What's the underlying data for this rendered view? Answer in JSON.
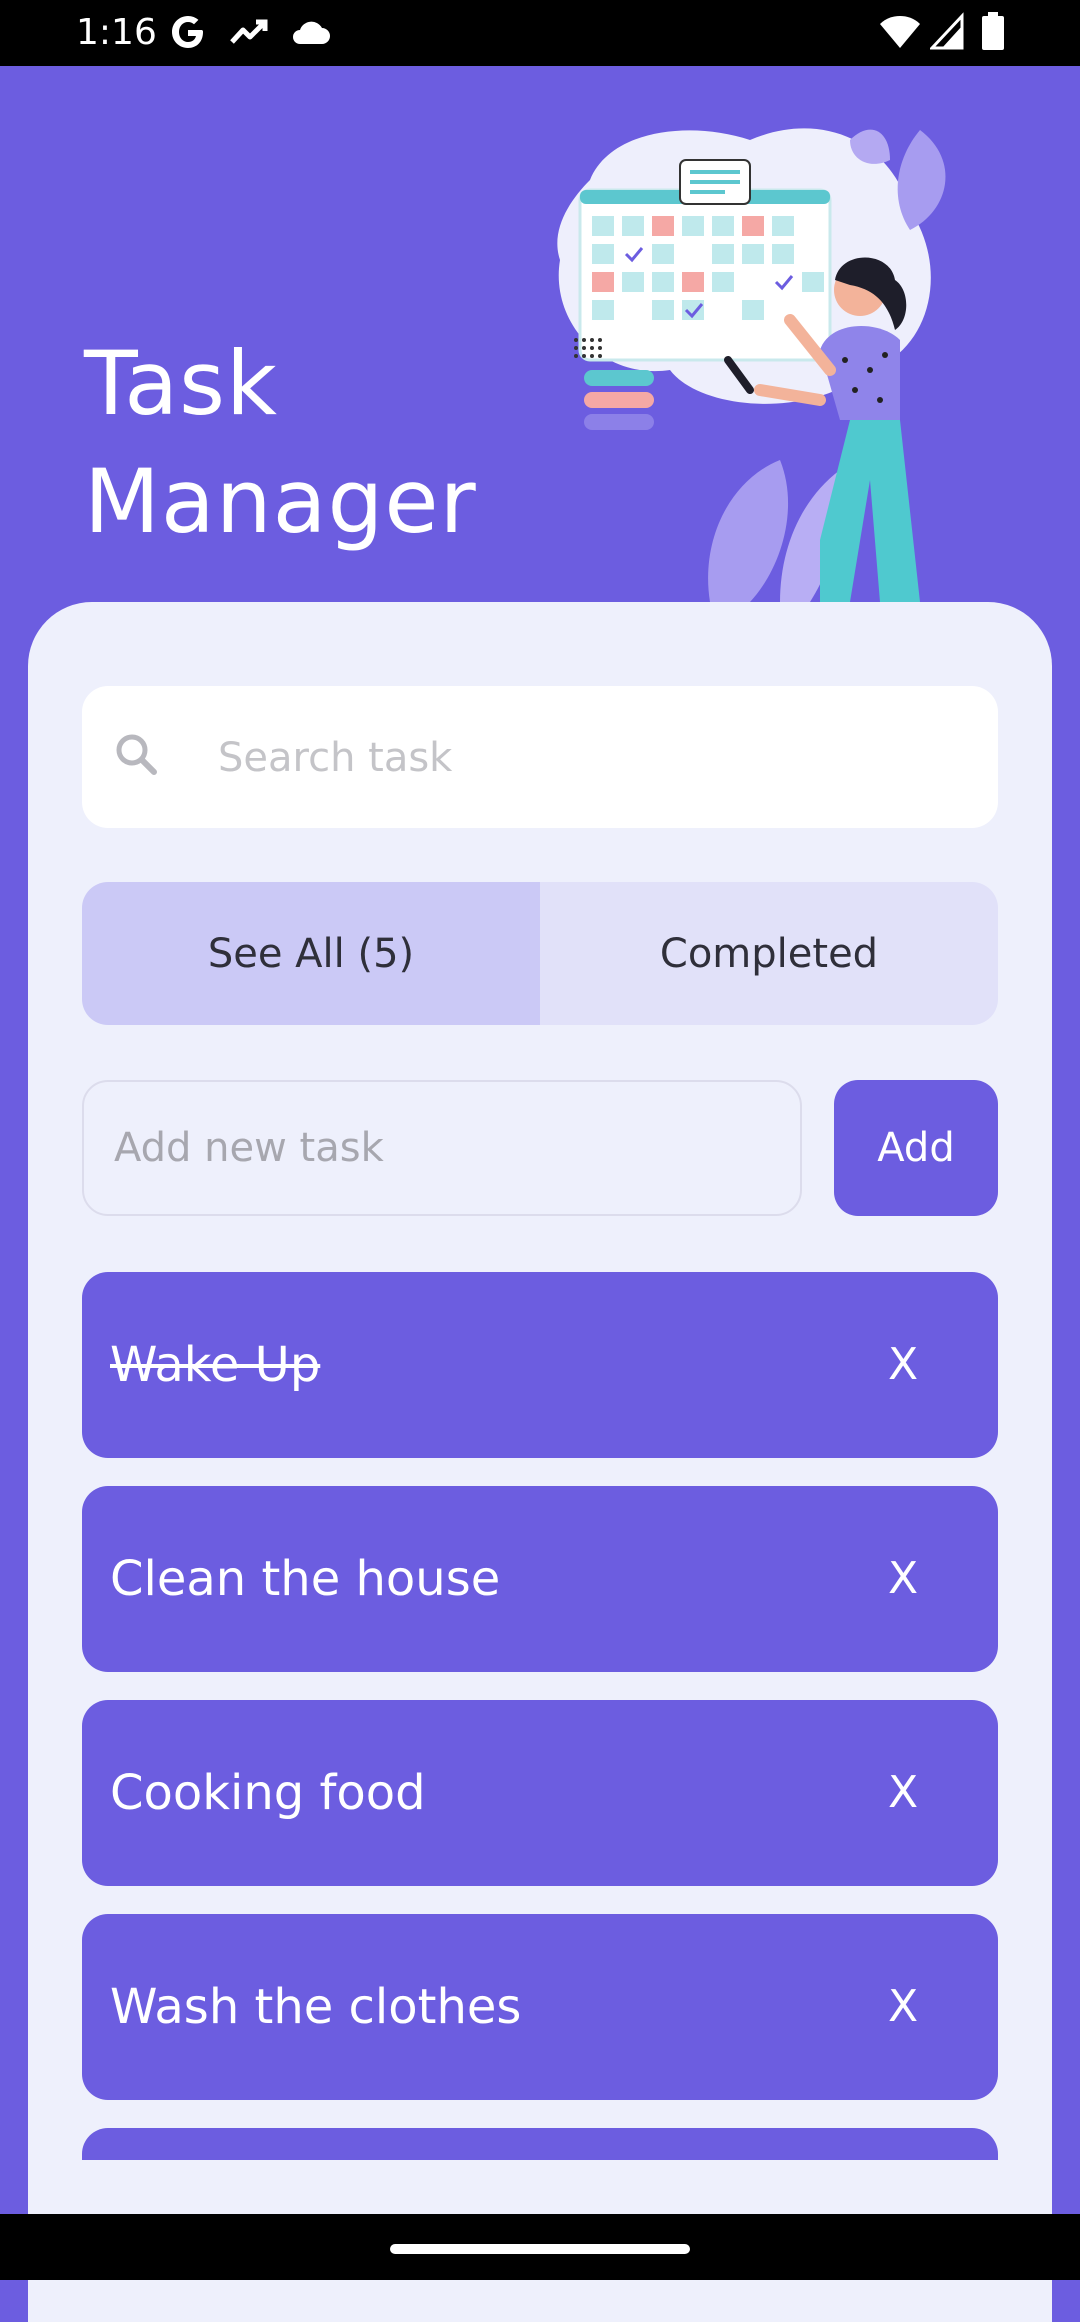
{
  "status_bar": {
    "time": "1:16",
    "left_icons": [
      "google-icon",
      "trending-icon",
      "cloud-icon"
    ],
    "right_icons": [
      "wifi-icon",
      "signal-icon",
      "battery-icon"
    ]
  },
  "header": {
    "title": "Task Manager"
  },
  "search": {
    "placeholder": "Search task"
  },
  "tabs": [
    {
      "label": "See All (5)",
      "active": true
    },
    {
      "label": "Completed",
      "active": false
    }
  ],
  "add_task": {
    "placeholder": "Add new task",
    "button_label": "Add"
  },
  "tasks": [
    {
      "label": "Wake Up",
      "completed": true,
      "delete_label": "X"
    },
    {
      "label": "Clean the house",
      "completed": false,
      "delete_label": "X"
    },
    {
      "label": "Cooking food",
      "completed": false,
      "delete_label": "X"
    },
    {
      "label": "Wash the clothes",
      "completed": false,
      "delete_label": "X"
    }
  ],
  "colors": {
    "primary": "#6C5DE0",
    "card_background": "#EEF0FC",
    "tab_active": "#CBC9F6",
    "tab_inactive": "#E1E1F9"
  }
}
